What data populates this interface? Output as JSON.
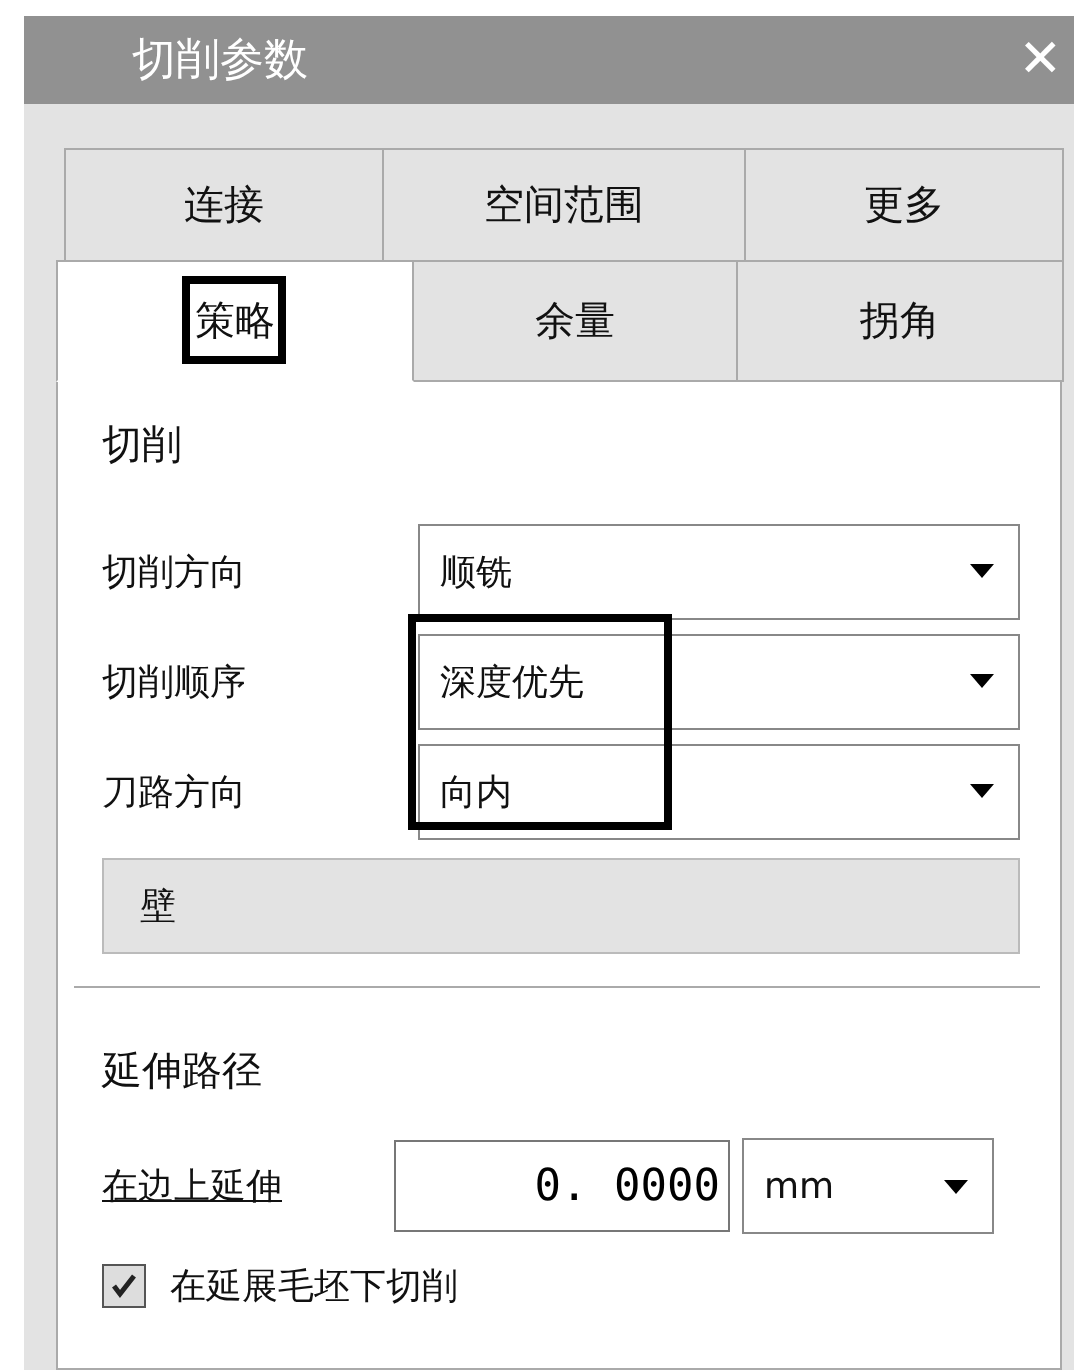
{
  "window": {
    "title": "切削参数",
    "close": "✕"
  },
  "tab_rows": [
    [
      {
        "label": "连接",
        "selected": false,
        "highlighted": false
      },
      {
        "label": "空间范围",
        "selected": false,
        "highlighted": false
      },
      {
        "label": "更多",
        "selected": false,
        "highlighted": false
      }
    ],
    [
      {
        "label": "策略",
        "selected": true,
        "highlighted": true
      },
      {
        "label": "余量",
        "selected": false,
        "highlighted": false
      },
      {
        "label": "拐角",
        "selected": false,
        "highlighted": false
      }
    ]
  ],
  "cutting": {
    "heading": "切削",
    "fields": [
      {
        "label": "切削方向",
        "value": "顺铣",
        "highlighted": false
      },
      {
        "label": "切削顺序",
        "value": "深度优先",
        "highlighted": true
      },
      {
        "label": "刀路方向",
        "value": "向内",
        "highlighted": true
      }
    ],
    "group": "壁"
  },
  "extend": {
    "heading": "延伸路径",
    "field": {
      "label": "在边上延伸",
      "value": "0. 0000",
      "unit": "mm"
    },
    "checkbox": {
      "label": "在延展毛坯下切削",
      "checked": true
    }
  }
}
